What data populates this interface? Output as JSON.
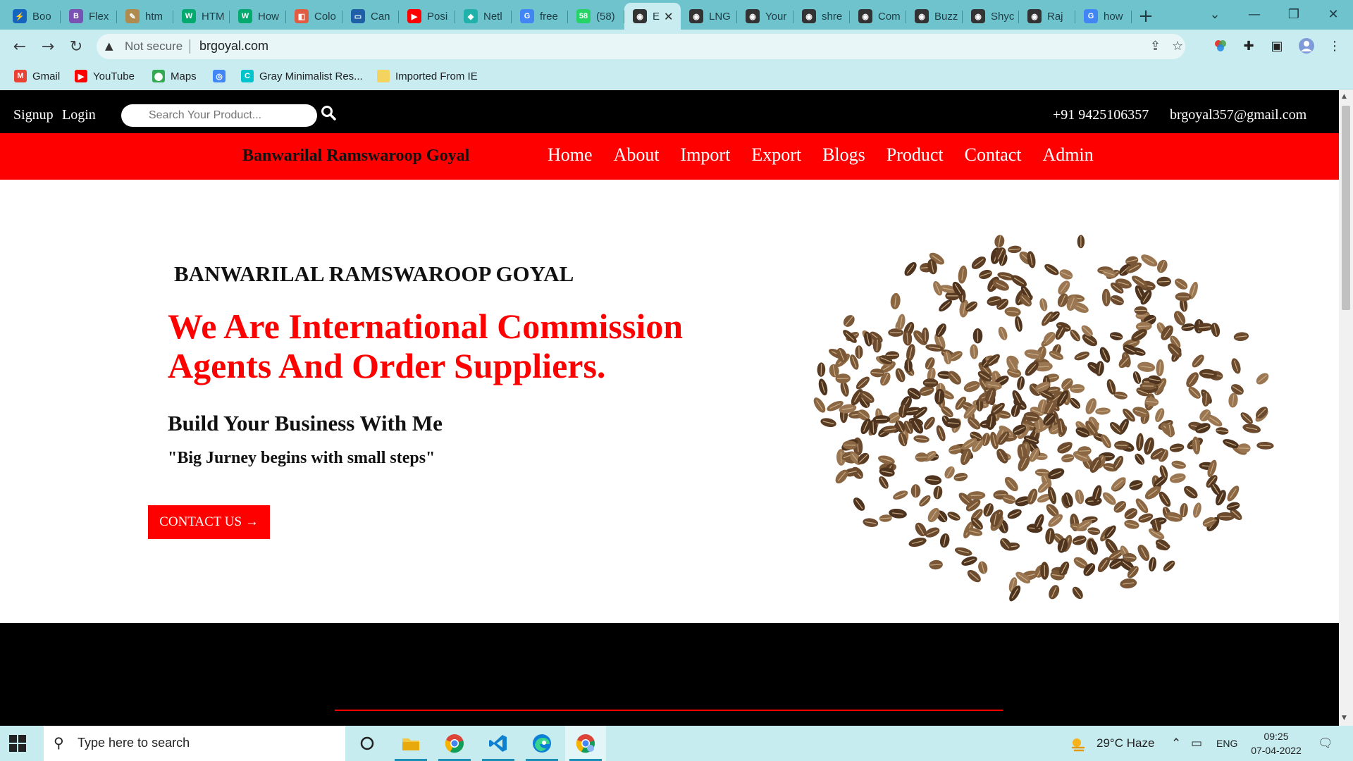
{
  "browser": {
    "tabs": [
      {
        "title": "Boo",
        "icon": "stackblitz-icon",
        "color": "#1565c0",
        "glyph": "⚡"
      },
      {
        "title": "Flex",
        "icon": "bootstrap-icon",
        "color": "#7952b3",
        "glyph": "B"
      },
      {
        "title": "htm",
        "icon": "pen-icon",
        "color": "#b08b4f",
        "glyph": "✎"
      },
      {
        "title": "HTM",
        "icon": "w3schools-icon",
        "color": "#04aa6d",
        "glyph": "W"
      },
      {
        "title": "How",
        "icon": "w3schools-icon",
        "color": "#04aa6d",
        "glyph": "W"
      },
      {
        "title": "Colo",
        "icon": "palette-icon",
        "color": "#e05d44",
        "glyph": "◧"
      },
      {
        "title": "Can",
        "icon": "monitor-icon",
        "color": "#1e5fa8",
        "glyph": "▭"
      },
      {
        "title": "Posi",
        "icon": "youtube-icon",
        "color": "#ff0000",
        "glyph": "▶"
      },
      {
        "title": "Netl",
        "icon": "netlify-icon",
        "color": "#20b2aa",
        "glyph": "◆"
      },
      {
        "title": "free",
        "icon": "google-icon",
        "color": "#4285f4",
        "glyph": "G"
      },
      {
        "title": "(58)",
        "icon": "whatsapp-icon",
        "color": "#25d366",
        "glyph": "58"
      },
      {
        "title": "E",
        "icon": "globe-icon",
        "color": "#333333",
        "glyph": "◉",
        "active": true
      },
      {
        "title": "LNG",
        "icon": "globe-icon",
        "color": "#333333",
        "glyph": "◉"
      },
      {
        "title": "Your",
        "icon": "globe-icon",
        "color": "#333333",
        "glyph": "◉"
      },
      {
        "title": "shre",
        "icon": "globe-icon",
        "color": "#333333",
        "glyph": "◉"
      },
      {
        "title": "Com",
        "icon": "globe-icon",
        "color": "#333333",
        "glyph": "◉"
      },
      {
        "title": "Buzz",
        "icon": "globe-icon",
        "color": "#333333",
        "glyph": "◉"
      },
      {
        "title": "Shyc",
        "icon": "globe-icon",
        "color": "#333333",
        "glyph": "◉"
      },
      {
        "title": "Raj",
        "icon": "globe-icon",
        "color": "#333333",
        "glyph": "◉"
      },
      {
        "title": "how",
        "icon": "google-icon",
        "color": "#4285f4",
        "glyph": "G"
      }
    ],
    "security_label": "Not secure",
    "url": "brgoyal.com",
    "bookmarks": [
      {
        "label": "Gmail",
        "icon": "gmail-icon",
        "color": "#ea4335",
        "glyph": "M"
      },
      {
        "label": "YouTube",
        "icon": "youtube-icon",
        "color": "#ff0000",
        "glyph": "▶"
      },
      {
        "label": "Maps",
        "icon": "maps-icon",
        "color": "#34a853",
        "glyph": "⬤"
      },
      {
        "label": "",
        "icon": "chrome-icon",
        "color": "#4285f4",
        "glyph": "◎"
      },
      {
        "label": "Gray Minimalist Res...",
        "icon": "canva-icon",
        "color": "#00c4cc",
        "glyph": "C"
      },
      {
        "label": "Imported From IE",
        "icon": "folder-icon",
        "color": "#f4d35e",
        "glyph": ""
      }
    ]
  },
  "site": {
    "topbar": {
      "signup": "Signup",
      "login": "Login",
      "search_placeholder": "Search Your Product...",
      "phone": "+91 9425106357",
      "email": "brgoyal357@gmail.com"
    },
    "brand": "Banwarilal Ramswaroop Goyal",
    "nav": [
      "Home",
      "About",
      "Import",
      "Export",
      "Blogs",
      "Product",
      "Contact",
      "Admin"
    ],
    "hero": {
      "company": "BANWARILAL RAMSWAROOP GOYAL",
      "headline_line1": "We Are International Commission",
      "headline_line2": "Agents And Order Suppliers.",
      "tagline": "Build Your Business With Me",
      "quote": "\"Big Jurney begins with small steps\"",
      "cta": "CONTACT US →"
    },
    "colors": {
      "accent": "#ff0000",
      "dark": "#000000"
    }
  },
  "taskbar": {
    "search_placeholder": "Type here to search",
    "weather": "29°C  Haze",
    "language": "ENG",
    "time": "09:25",
    "date": "07-04-2022"
  }
}
